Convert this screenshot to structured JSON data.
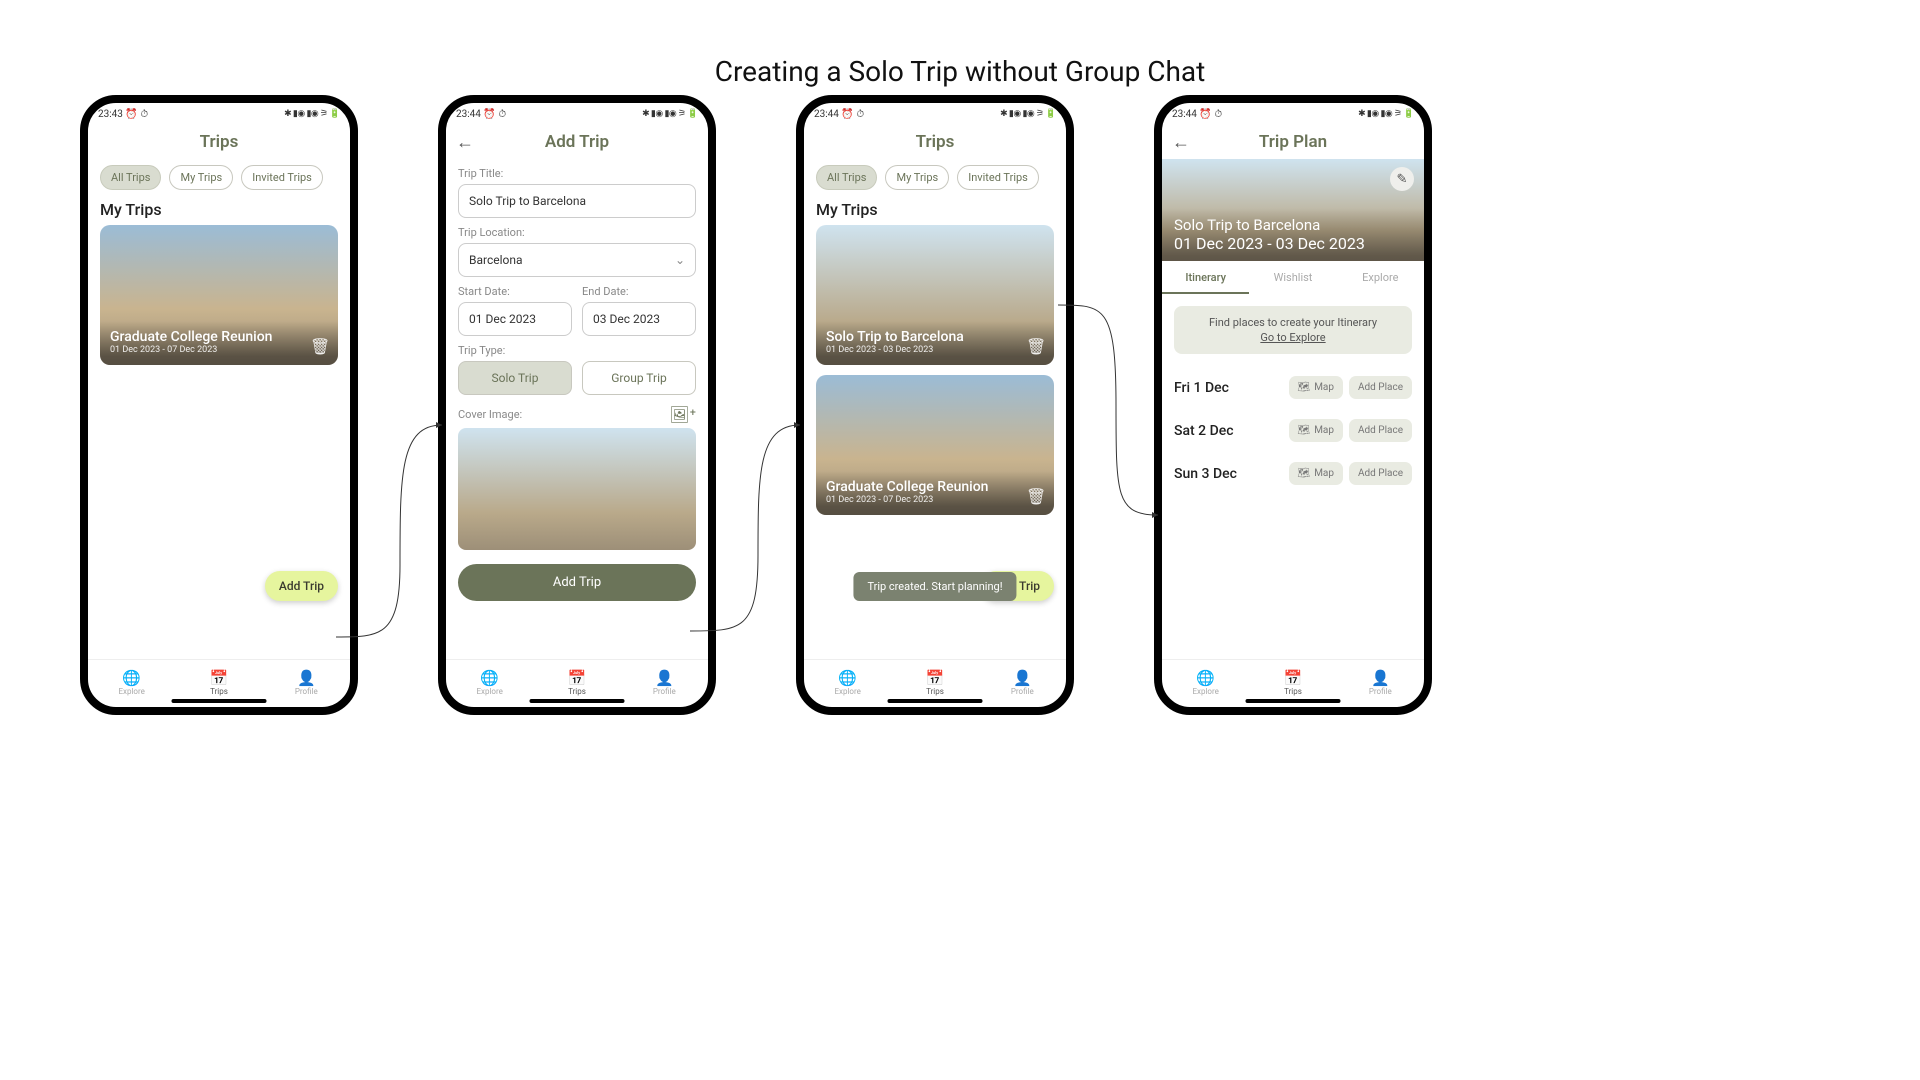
{
  "page_title": "Creating a Solo Trip without Group Chat",
  "status": {
    "time1": "23:43 ⏰ ⏱",
    "time2": "23:44 ⏰ ⏱",
    "right": "✱ ▮◉ ▮◉ ⚞ 🔋"
  },
  "nav": {
    "explore": "Explore",
    "trips": "Trips",
    "profile": "Profile"
  },
  "screen1": {
    "title": "Trips",
    "chips": {
      "all": "All Trips",
      "mine": "My Trips",
      "invited": "Invited Trips"
    },
    "section": "My Trips",
    "trip": {
      "title": "Graduate College Reunion",
      "dates": "01 Dec 2023 - 07 Dec 2023"
    },
    "fab": "Add Trip"
  },
  "screen2": {
    "title": "Add Trip",
    "labels": {
      "title": "Trip Title:",
      "location": "Trip Location:",
      "start": "Start Date:",
      "end": "End Date:",
      "type": "Trip Type:",
      "cover": "Cover Image:"
    },
    "values": {
      "title": "Solo Trip to Barcelona",
      "location": "Barcelona",
      "start": "01 Dec 2023",
      "end": "03 Dec 2023"
    },
    "types": {
      "solo": "Solo Trip",
      "group": "Group Trip"
    },
    "submit": "Add Trip"
  },
  "screen3": {
    "title": "Trips",
    "chips": {
      "all": "All Trips",
      "mine": "My Trips",
      "invited": "Invited Trips"
    },
    "section": "My Trips",
    "trip_new": {
      "title": "Solo Trip to Barcelona",
      "dates": "01 Dec 2023 - 03 Dec 2023"
    },
    "trip_old": {
      "title": "Graduate College Reunion",
      "dates": "01 Dec 2023 - 07 Dec 2023"
    },
    "fab": "Add Trip",
    "toast": "Trip created. Start planning!"
  },
  "screen4": {
    "title": "Trip Plan",
    "hero": {
      "title": "Solo Trip to Barcelona",
      "dates": "01 Dec 2023 - 03 Dec 2023"
    },
    "tabs": {
      "itinerary": "Itinerary",
      "wishlist": "Wishlist",
      "explore": "Explore"
    },
    "banner": {
      "text": "Find places to create your Itinerary",
      "link": "Go to Explore"
    },
    "days": [
      {
        "label": "Fri 1 Dec"
      },
      {
        "label": "Sat 2 Dec"
      },
      {
        "label": "Sun 3 Dec"
      }
    ],
    "btn_map": "Map",
    "btn_add": "Add Place"
  }
}
